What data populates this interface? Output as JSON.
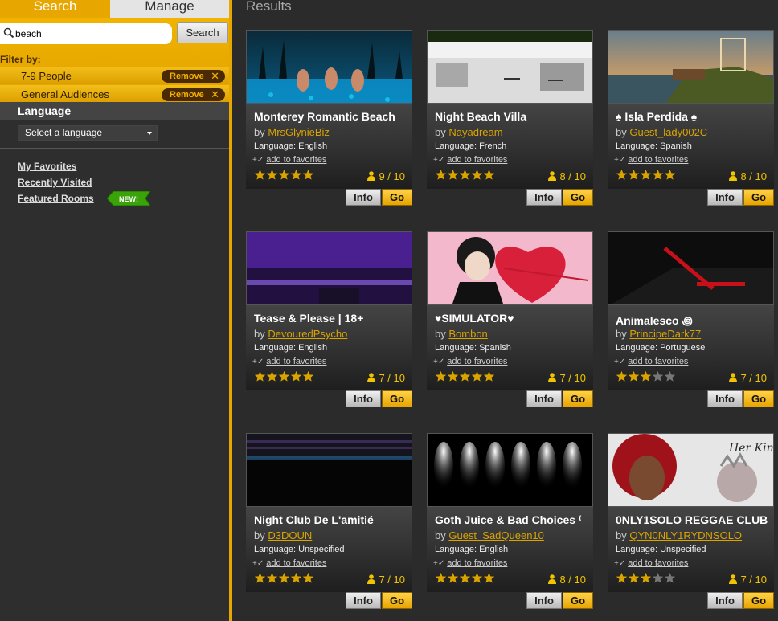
{
  "tabs": {
    "search": "Search",
    "manage": "Manage"
  },
  "search": {
    "value": "beach",
    "button": "Search"
  },
  "filters": {
    "label": "Filter by:",
    "remove_label": "Remove",
    "items": [
      {
        "name": "7-9 People"
      },
      {
        "name": "General Audiences"
      }
    ]
  },
  "language": {
    "header": "Language",
    "select_value": "Select a language"
  },
  "links": {
    "favorites": "My Favorites",
    "recent": "Recently Visited",
    "featured": "Featured Rooms",
    "new_badge": "NEW!"
  },
  "results": {
    "title": "Results",
    "by": "by",
    "language_prefix": "Language:",
    "add_favorites": "add to favorites",
    "info": "Info",
    "go": "Go",
    "rooms": [
      {
        "title": "Monterey Romantic Beach",
        "owner": "MrsGlynieBiz",
        "language": "English",
        "rating": 5,
        "people": "9 / 10",
        "thumb": "beach-night-pool"
      },
      {
        "title": "Night Beach Villa",
        "owner": "Nayadream",
        "language": "French",
        "rating": 5,
        "people": "8 / 10",
        "thumb": "white-villa"
      },
      {
        "title": "♠ Isla Perdida ♠",
        "owner": "Guest_lady002C",
        "language": "Spanish",
        "rating": 5,
        "people": "8 / 10",
        "thumb": "island-sunset"
      },
      {
        "title": "Tease & Please | 18+",
        "owner": "DevouredPsycho",
        "language": "English",
        "rating": 5,
        "people": "7 / 10",
        "thumb": "purple-room"
      },
      {
        "title": "♥SIMULATOR♥",
        "owner": "Bombon",
        "language": "Spanish",
        "rating": 5,
        "people": "7 / 10",
        "thumb": "anime-heart"
      },
      {
        "title": "Animalesco ꩜",
        "owner": "PrincipeDark77",
        "language": "Portuguese",
        "rating": 3,
        "people": "7 / 10",
        "thumb": "dark-red-room"
      },
      {
        "title": "Night Club De L'amitié",
        "owner": "D3DOUN",
        "language": "Unspecified",
        "rating": 5,
        "people": "7 / 10",
        "thumb": "club-lights"
      },
      {
        "title": "Goth Juice & Bad Choices ⁽",
        "owner": "Guest_SadQueen10",
        "language": "English",
        "rating": 5,
        "people": "8 / 10",
        "thumb": "spotlights"
      },
      {
        "title": "0NLY1SOLO REGGAE CLUB",
        "owner": "QYN0NLY1RYDNSOLO",
        "language": "Unspecified",
        "rating": 3,
        "people": "7 / 10",
        "thumb": "her-king"
      }
    ]
  },
  "colors": {
    "accent": "#e8a600",
    "star": "#d9a400",
    "star_empty": "#777777",
    "owner_link": "#d9a400"
  }
}
